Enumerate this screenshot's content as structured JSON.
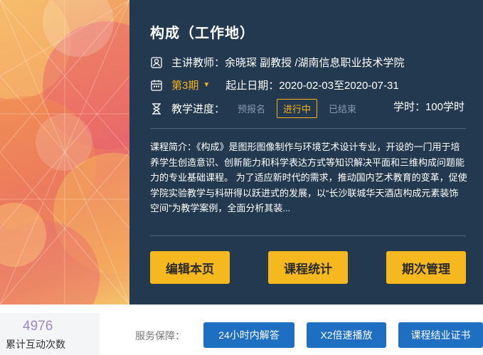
{
  "course": {
    "title": "构成（工作地）",
    "teacher": "主讲教师：余晓琛 副教授 /湖南信息职业技术学院",
    "period": "第3期",
    "dates": "起止日期：2020-02-03至2020-07-31",
    "progress_label": "教学进度：",
    "stages": [
      "预报名",
      "进行中",
      "已结束"
    ],
    "active_stage": "进行中",
    "hours": "学时：100学时",
    "intro": "课程简介：《构成》是图形图像制作与环境艺术设计专业，开设的一门用于培养学生创造意识、创新能力和科学表达方式等知识解决平面和三维构成问题能力的专业基础课程。 为了适应新时代的需求，推动国内艺术教育的变革，促使学院实验教学与科研得以跃进式的发展，以“长沙联城华天酒店构成元素装饰空间”为教学案例，全面分析其装..."
  },
  "actions": {
    "edit": "编辑本页",
    "stats": "课程统计",
    "periods": "期次管理"
  },
  "footer": {
    "count": "4976",
    "count_label": "累计互动次数",
    "service_label": "服务保障：",
    "services": [
      "24小时内解答",
      "X2倍速播放",
      "课程结业证书"
    ]
  },
  "colors": {
    "hero_bg": "#22394f",
    "accent_yellow": "#f6b81f",
    "service_blue": "#1e6fc1",
    "count_purple": "#9f85c5"
  },
  "icons": [
    "teacher-icon",
    "calendar-icon",
    "hourglass-icon",
    "caret-down-icon"
  ]
}
